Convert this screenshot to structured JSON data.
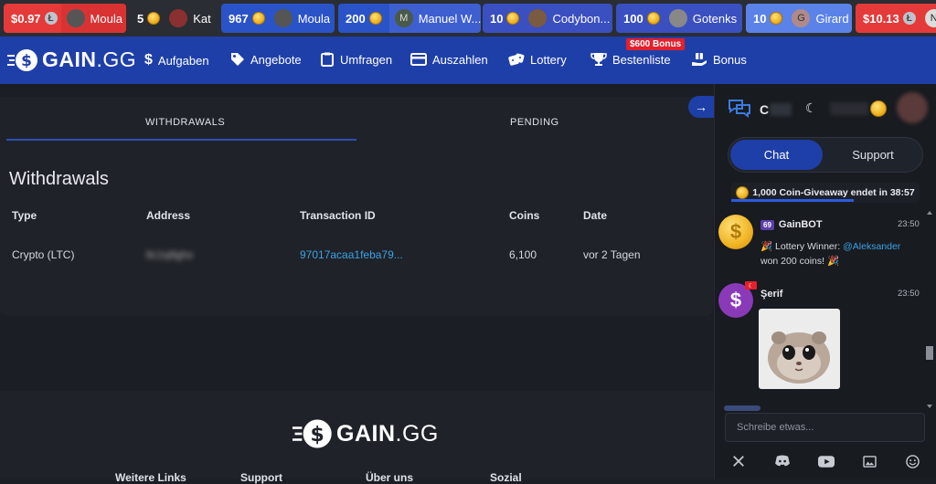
{
  "ticker": [
    {
      "amount": "$0.97",
      "currency": "ltc",
      "name": "Moula",
      "color": "#e53a3a",
      "avatar": "moula"
    },
    {
      "amount": "5",
      "currency": "coin",
      "name": "Kat",
      "color": "#2a2d33",
      "avatar": "kat"
    },
    {
      "amount": "967",
      "currency": "coin",
      "name": "Moula",
      "color": "#2a53c8",
      "avatar": "moula"
    },
    {
      "amount": "200",
      "currency": "coin",
      "name": "Manuel W...",
      "color": "#2a53c8",
      "avatar": "M"
    },
    {
      "amount": "10",
      "currency": "coin",
      "name": "Codybon...",
      "color": "#3a4fc0",
      "avatar": "cody"
    },
    {
      "amount": "100",
      "currency": "coin",
      "name": "Gotenks",
      "color": "#3a4fc0",
      "avatar": "gotenks"
    },
    {
      "amount": "10",
      "currency": "coin",
      "name": "Girard",
      "color": "#5a82e8",
      "avatar": "G"
    },
    {
      "amount": "$10.13",
      "currency": "ltc",
      "name": "N",
      "color": "#e53a3a",
      "avatar": "N"
    }
  ],
  "nav": {
    "logo_main": "GAIN",
    "logo_tld": ".GG",
    "items": [
      "Aufgaben",
      "Angebote",
      "Umfragen",
      "Auszahlen",
      "Lottery",
      "Bestenliste",
      "Bonus"
    ],
    "bonus_badge": "$600 Bonus"
  },
  "tabs": {
    "withdrawals": "WITHDRAWALS",
    "pending": "PENDING"
  },
  "section_title": "Withdrawals",
  "table": {
    "headers": [
      "Type",
      "Address",
      "Transaction ID",
      "Coins",
      "Date"
    ],
    "rows": [
      {
        "type": "Crypto (LTC)",
        "address": "ltc1q9ghx",
        "txid": "97017acaa1feba79...",
        "coins": "6,100",
        "date": "vor 2 Tagen"
      }
    ]
  },
  "footer": {
    "logo_main": "GAIN",
    "logo_tld": ".GG",
    "columns": [
      "Weitere Links",
      "Support",
      "Über uns",
      "Sozial"
    ]
  },
  "sidebar": {
    "user_initial": "C",
    "tabs": {
      "chat": "Chat",
      "support": "Support"
    },
    "giveaway": "1,000 Coin-Giveaway endet in 38:57",
    "messages": [
      {
        "name": "GainBOT",
        "level": "69",
        "time": "23:50",
        "text_line1": "🎉 Lottery Winner: ",
        "mention": "@Aleksander",
        "text_line2": "won 200 coins! 🎉"
      },
      {
        "name": "Şerif",
        "time": "23:50"
      }
    ],
    "input_placeholder": "Schreibe etwas..."
  },
  "colors": {
    "brand_blue": "#1f3fa8",
    "accent_link": "#3ba3e8",
    "coin_gold": "#f0b323"
  }
}
